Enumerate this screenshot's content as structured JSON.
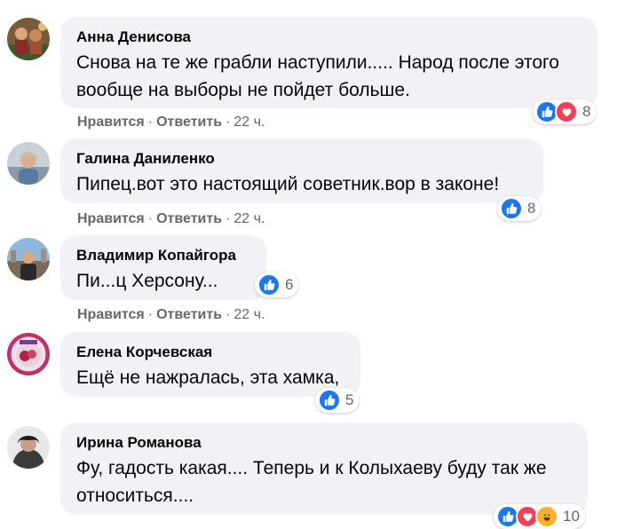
{
  "colors": {
    "like": "#1877f2",
    "love": "#f33e58",
    "haha": "#f7b125",
    "bubble": "#f0f2f5",
    "meta_text": "#65676b"
  },
  "actions": {
    "like_label": "Нравится",
    "reply_label": "Ответить",
    "separator": "·"
  },
  "comments": [
    {
      "author": "Анна Денисова",
      "text": "Снова на те же грабли наступили..... Народ после этого вообще на выборы не пойдет больше.",
      "time": "22 ч.",
      "reactions": [
        "like-icon",
        "love-icon"
      ],
      "reaction_count": "8"
    },
    {
      "author": "Галина Даниленко",
      "text": "Пипец.вот это настоящий советник.вор в законе!",
      "time": "22 ч.",
      "reactions": [
        "like-icon"
      ],
      "reaction_count": "8"
    },
    {
      "author": "Владимир Копайгора",
      "text": "Пи...ц Херсону...",
      "time": "22 ч.",
      "reactions": [
        "like-icon"
      ],
      "reaction_count": "6"
    },
    {
      "author": "Елена Корчевская",
      "text": "Ещё не нажралась, эта хамка,",
      "reactions": [
        "like-icon"
      ],
      "reaction_count": "5"
    },
    {
      "author": "Ирина Романова",
      "text": "Фу, гадость какая.... Теперь и к Колыхаеву буду так же относиться....",
      "reactions": [
        "like-icon",
        "love-icon",
        "haha-icon"
      ],
      "reaction_count": "10"
    }
  ]
}
